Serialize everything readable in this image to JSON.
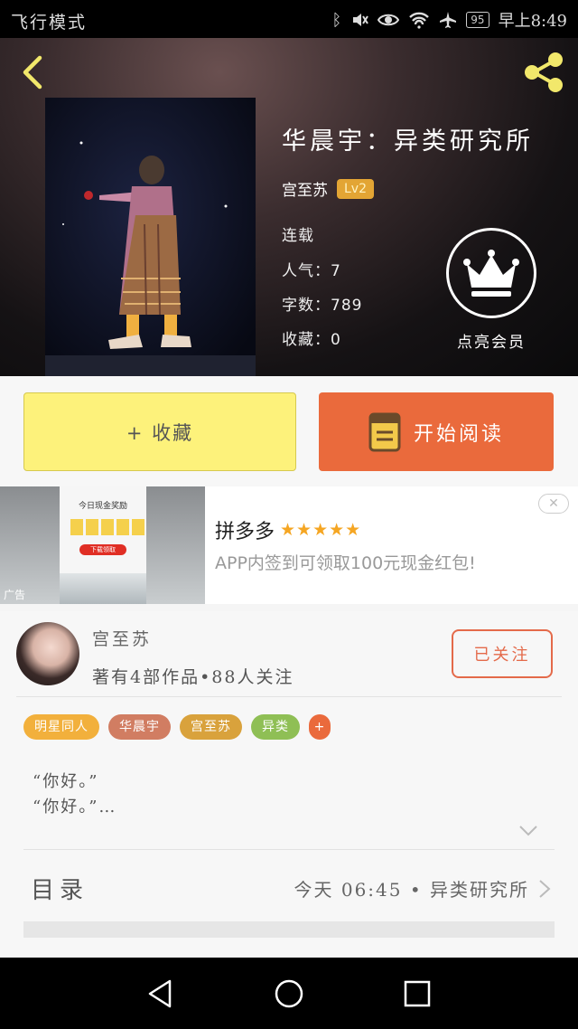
{
  "status_bar": {
    "mode": "飞行模式",
    "battery": "95",
    "time": "早上8:49",
    "icons": [
      "bluetooth-icon",
      "mute-icon",
      "eye-icon",
      "wifi-icon",
      "airplane-icon",
      "battery-icon"
    ]
  },
  "header": {
    "back_icon": "chevron-left-icon",
    "share_icon": "share-icon",
    "accent": "#f2e86b"
  },
  "book": {
    "title": "华晨宇：异类研究所",
    "author": "宫至苏",
    "level": "Lv2",
    "status": "连载",
    "popularity": "人气：7",
    "word_count": "字数：789",
    "favorites": "收藏：0"
  },
  "vip": {
    "icon": "crown-icon",
    "label": "点亮会员"
  },
  "actions": {
    "collect": "+ 收藏",
    "read": "开始阅读",
    "collect_color": "#fdf27b",
    "read_color": "#ea6a3c"
  },
  "ad": {
    "tag": "广告",
    "brand": "拼多多",
    "stars": "★★★★★",
    "description": "APP内签到可领取100元现金红包!",
    "close": "✕",
    "phone_title": "今日现金奖励",
    "phone_button": "下载领取"
  },
  "author_card": {
    "name": "宫至苏",
    "stats": "著有4部作品•88人关注",
    "follow_label": "已关注"
  },
  "tags": [
    {
      "label": "明星同人",
      "color": "#f2b03c"
    },
    {
      "label": "华晨宇",
      "color": "#d17d62"
    },
    {
      "label": "宫至苏",
      "color": "#d9a23c"
    },
    {
      "label": "异类",
      "color": "#8fbf55"
    },
    {
      "label": "+",
      "color": "#ea6a3c"
    }
  ],
  "intro": {
    "line1": "“你好。”",
    "line2": "“你好。”…"
  },
  "toc": {
    "label": "目录",
    "info": "今天 06:45 • 异类研究所"
  }
}
